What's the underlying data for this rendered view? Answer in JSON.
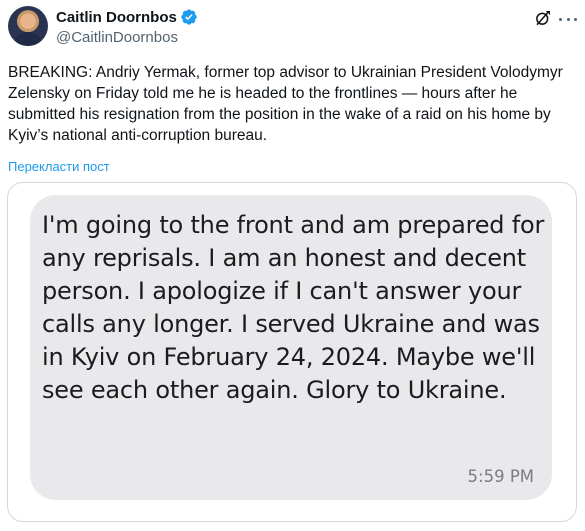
{
  "author": {
    "display_name": "Caitlin Doornbos",
    "handle": "@CaitlinDoornbos",
    "verified": true,
    "verified_color": "#1d9bf0"
  },
  "header_icons": [
    "grok-icon",
    "more-icon"
  ],
  "tweet": {
    "text": "BREAKING: Andriy Yermak, former top advisor to Ukrainian President Volodymyr Zelensky on Friday told me he is headed to the frontlines — hours after he submitted his resignation from the position in the wake of a raid on his home by Kyiv’s national anti-corruption bureau.",
    "translate_label": "Перекласти пост"
  },
  "media": {
    "message_text": "I'm going to the front and am prepared for any reprisals. I am an honest and decent person. I apologize if I can't answer your calls any longer. I served Ukraine and was in Kyiv on February 24, 2024. Maybe we'll see each other again. Glory to Ukraine.",
    "timestamp": "5:59 PM"
  },
  "colors": {
    "text": "#0f1419",
    "secondary": "#536471",
    "link": "#1d9bf0",
    "bubble": "#e9e9eb"
  }
}
